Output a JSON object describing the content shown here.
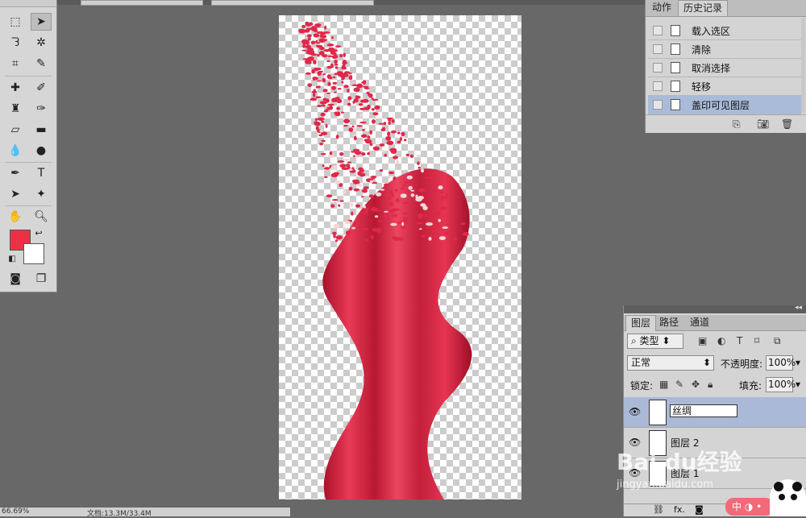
{
  "history": {
    "tabs": [
      "动作",
      "历史记录"
    ],
    "items": [
      "载入选区",
      "清除",
      "取消选择",
      "轻移",
      "盖印可见图层"
    ],
    "selected_index": 4
  },
  "layers": {
    "tabs": [
      "图层",
      "路径",
      "通道"
    ],
    "filter_kind": "类型",
    "blend_mode": "正常",
    "opacity_label": "不透明度:",
    "opacity_value": "100%",
    "lock_label": "锁定:",
    "fill_label": "填充:",
    "fill_value": "100%",
    "layer_list": [
      {
        "name": "丝绸",
        "editing": true
      },
      {
        "name": "图层 2"
      },
      {
        "name": "图层 1"
      }
    ],
    "footer_fx": "fx."
  },
  "status": {
    "zoom": "66.69%",
    "doc": "文档:13.3M/33.4M"
  },
  "watermark": {
    "logo_text": "Bai du经验",
    "url": "jingyan.baidu.com"
  },
  "colors": {
    "foreground": "#ee3047",
    "background": "#ffffff",
    "accent_select": "#a9bbd9"
  },
  "ime_badge": "中"
}
